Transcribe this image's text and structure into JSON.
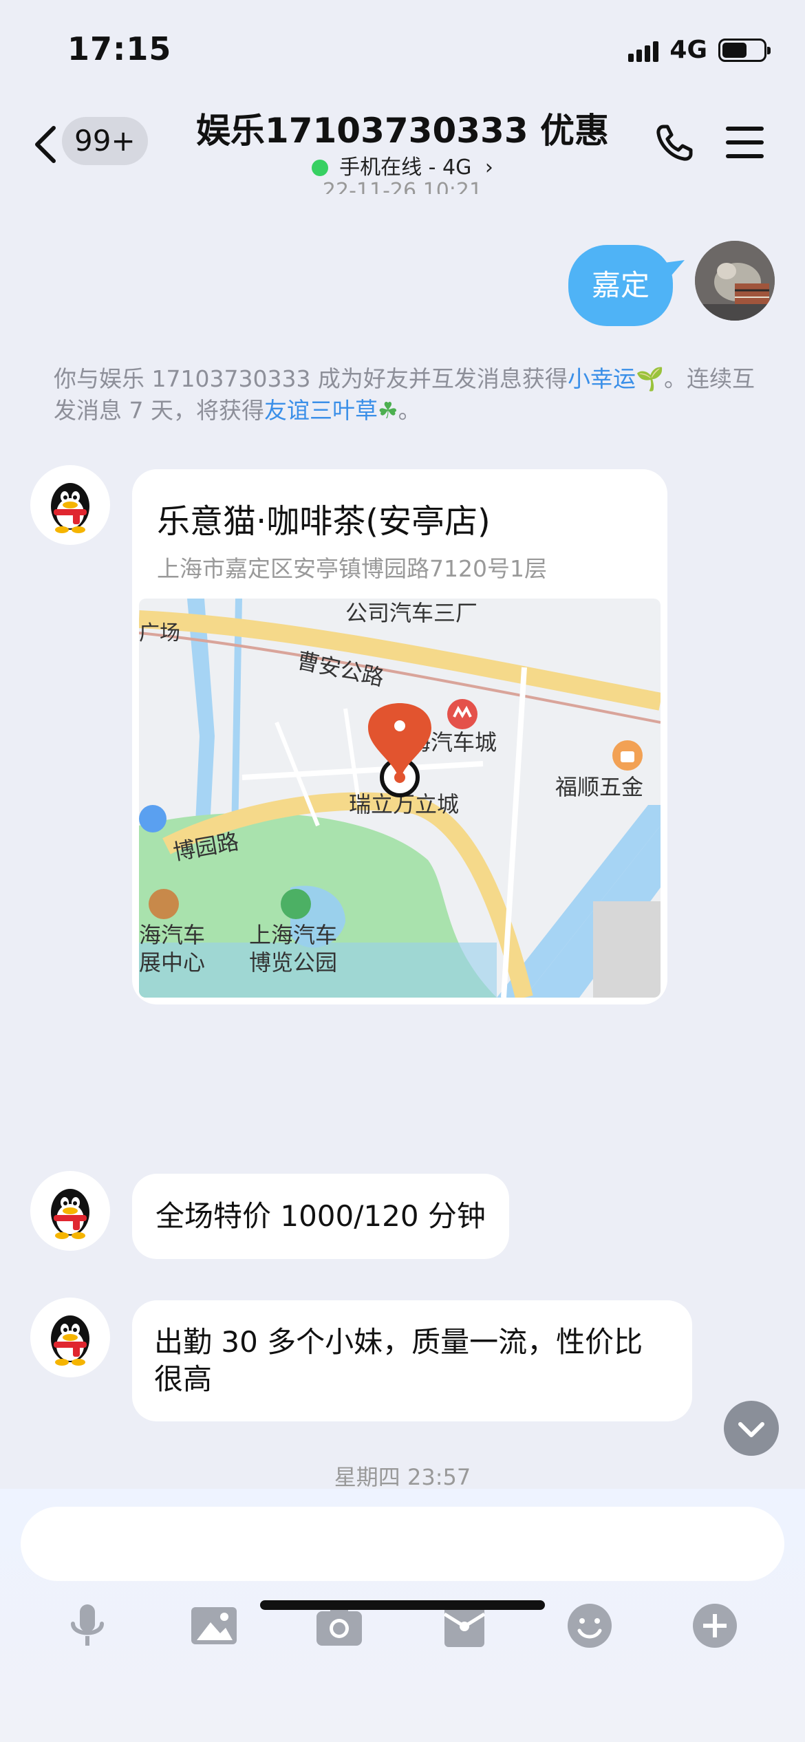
{
  "status_bar": {
    "time": "17:15",
    "network": "4G",
    "battery_percent": 60
  },
  "header": {
    "unread_count": "99+",
    "title": "娱乐17103730333 优惠",
    "subtitle": "手机在线 - 4G",
    "subtitle_chevron": "›",
    "icons": [
      "back-chevron-icon",
      "phone-icon",
      "menu-icon"
    ]
  },
  "chat": {
    "partial_timestamp": "22-11-26 10:21",
    "my_message": "嘉定",
    "system_message": {
      "part1": "你与娱乐 17103730333 成为好友并互发消息获得",
      "link1": "小幸运",
      "emoji1": "🌱",
      "part2": "。连续互发消息 7 天，将获得",
      "link2": "友谊三叶草",
      "emoji2": "☘",
      "part3": "。"
    },
    "location_card": {
      "title": "乐意猫·咖啡茶(安亭店)",
      "address": "上海市嘉定区安亭镇博园路7120号1层",
      "map_labels": {
        "top_label": "公司汽车三厂",
        "left_label": "广场",
        "road_top": "曹安公路",
        "metro": "上海汽车城",
        "mall": "福顺五金",
        "poi": "瑞立万立城",
        "road_left": "博园路",
        "exhibit": "海汽车\n展中心",
        "park": "上海汽车\n博览公园"
      }
    },
    "messages": [
      {
        "text": "全场特价 1000/120 分钟"
      },
      {
        "text": "出勤 30 多个小妹，质量一流，性价比很高"
      }
    ],
    "bottom_timestamp": "星期四 23:57"
  },
  "input": {
    "placeholder": ""
  },
  "toolbar": [
    "microphone-icon",
    "image-icon",
    "camera-icon",
    "red-packet-icon",
    "emoji-icon",
    "plus-icon"
  ],
  "colors": {
    "accent_blue": "#4fb3f6",
    "link_blue": "#3a8fe8",
    "online_green": "#37d062",
    "map_pin": "#e2542f"
  }
}
